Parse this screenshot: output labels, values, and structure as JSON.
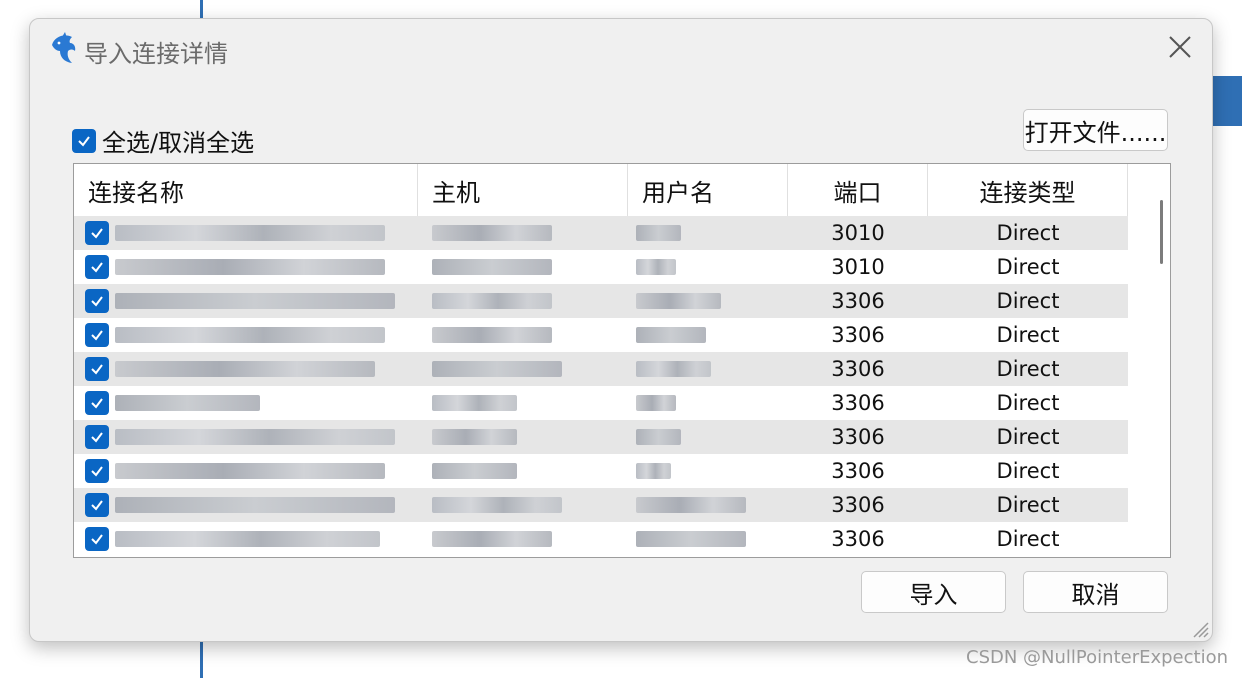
{
  "dialog": {
    "title": "导入连接详情",
    "icon": "dolphin-icon"
  },
  "select_all_label": "全选/取消全选",
  "buttons": {
    "open_file": "打开文件......",
    "import": "导入",
    "cancel": "取消"
  },
  "table": {
    "headers": {
      "name": "连接名称",
      "host": "主机",
      "user": "用户名",
      "port": "端口",
      "type": "连接类型"
    },
    "rows": [
      {
        "checked": true,
        "name": "",
        "host": "",
        "user": "",
        "port": "3010",
        "type": "Direct"
      },
      {
        "checked": true,
        "name": "",
        "host": "",
        "user": "",
        "port": "3010",
        "type": "Direct"
      },
      {
        "checked": true,
        "name": "",
        "host": "",
        "user": "",
        "port": "3306",
        "type": "Direct"
      },
      {
        "checked": true,
        "name": "",
        "host": "",
        "user": "",
        "port": "3306",
        "type": "Direct"
      },
      {
        "checked": true,
        "name": "",
        "host": "",
        "user": "",
        "port": "3306",
        "type": "Direct"
      },
      {
        "checked": true,
        "name": "",
        "host": "",
        "user": "",
        "port": "3306",
        "type": "Direct"
      },
      {
        "checked": true,
        "name": "",
        "host": "",
        "user": "",
        "port": "3306",
        "type": "Direct"
      },
      {
        "checked": true,
        "name": "",
        "host": "",
        "user": "",
        "port": "3306",
        "type": "Direct"
      },
      {
        "checked": true,
        "name": "",
        "host": "",
        "user": "",
        "port": "3306",
        "type": "Direct"
      },
      {
        "checked": true,
        "name": "",
        "host": "",
        "user": "",
        "port": "3306",
        "type": "Direct"
      }
    ]
  },
  "watermark": "CSDN @NullPointerExpection",
  "colors": {
    "accent": "#0a66c4",
    "dialog_bg": "#f0f0f0",
    "row_alt": "#e6e6e6",
    "background_line": "#2f6fb4"
  }
}
